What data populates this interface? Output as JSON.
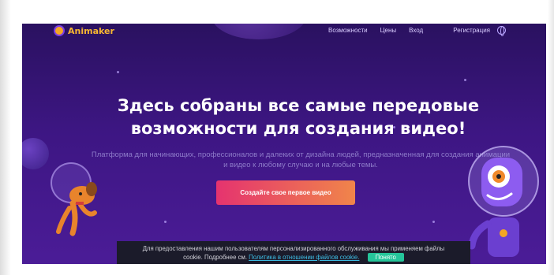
{
  "nav": {
    "logo_text": "Animaker",
    "items": [
      "Возможности",
      "Цены",
      "Вход",
      "Регистрация"
    ]
  },
  "hero": {
    "headline_line1": "Здесь собраны все самые передовые",
    "headline_line2": "возможности для создания видео!",
    "subtext_line1": "Платформа для начинающих, профессионалов и далеких от дизайна людей, предназначенная для создания анимации",
    "subtext_line2": "и видео к любому случаю и на любые темы.",
    "cta_label": "Создайте свое первое видео"
  },
  "cookie": {
    "text_line1": "Для предоставления нашим пользователям персонализированного обслуживания мы применяем файлы",
    "text_prefix": "cookie. Подробнее см.",
    "link_label": "Политика в отношении файлов cookie.",
    "button_label": "Понято"
  },
  "colors": {
    "background_top": "#2a1160",
    "background_bottom": "#4b1c97",
    "cta_start": "#e5336f",
    "cta_end": "#f0854a",
    "logo": "#f7b731",
    "cookie_button": "#25c59a",
    "cookie_link": "#3dbde4"
  },
  "icons": [
    "globe-icon",
    "animaker-logo-icon"
  ]
}
